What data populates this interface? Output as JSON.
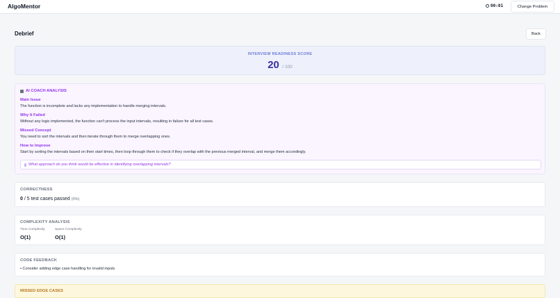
{
  "app": {
    "title": "AlgoMentor"
  },
  "topbar": {
    "timer": "00:01",
    "change_problem": "Change Problem"
  },
  "header": {
    "title": "Debrief",
    "back": "Back"
  },
  "score": {
    "label": "INTERVIEW READINESS SCORE",
    "value": "20",
    "max": "/ 100"
  },
  "coach": {
    "heading": "AI COACH ANALYSIS",
    "sections": [
      {
        "title": "Main Issue",
        "text": "The function is incomplete and lacks any implementation to handle merging intervals."
      },
      {
        "title": "Why It Failed",
        "text": "Without any logic implemented, the function can't process the input intervals, resulting in failure for all test cases."
      },
      {
        "title": "Missed Concept",
        "text": "You need to sort the intervals and then iterate through them to merge overlapping ones."
      },
      {
        "title": "How to Improve",
        "text": "Start by sorting the intervals based on their start times, then loop through them to check if they overlap with the previous merged interval, and merge them accordingly."
      }
    ],
    "question": "What approach do you think would be effective in identifying overlapping intervals?"
  },
  "correctness": {
    "label": "CORRECTNESS",
    "passed": "0",
    "total_text": "/ 5 test cases passed",
    "percent": "(0%)"
  },
  "complexity": {
    "label": "COMPLEXITY ANALYSIS",
    "time_label": "Time Complexity",
    "time_value": "O(1)",
    "space_label": "Space Complexity",
    "space_value": "O(1)"
  },
  "feedback": {
    "label": "CODE FEEDBACK",
    "items": [
      "• Consider adding edge case handling for invalid inputs"
    ]
  },
  "edge_cases": {
    "label": "MISSED EDGE CASES"
  },
  "colors": {
    "accent_purple": "#9333ea",
    "score_blue": "#3730a3",
    "edge_bg": "#fdf7dd"
  },
  "icons": {
    "timer": "stopwatch-icon",
    "coach": "robot-icon",
    "question": "lightbulb-icon"
  }
}
